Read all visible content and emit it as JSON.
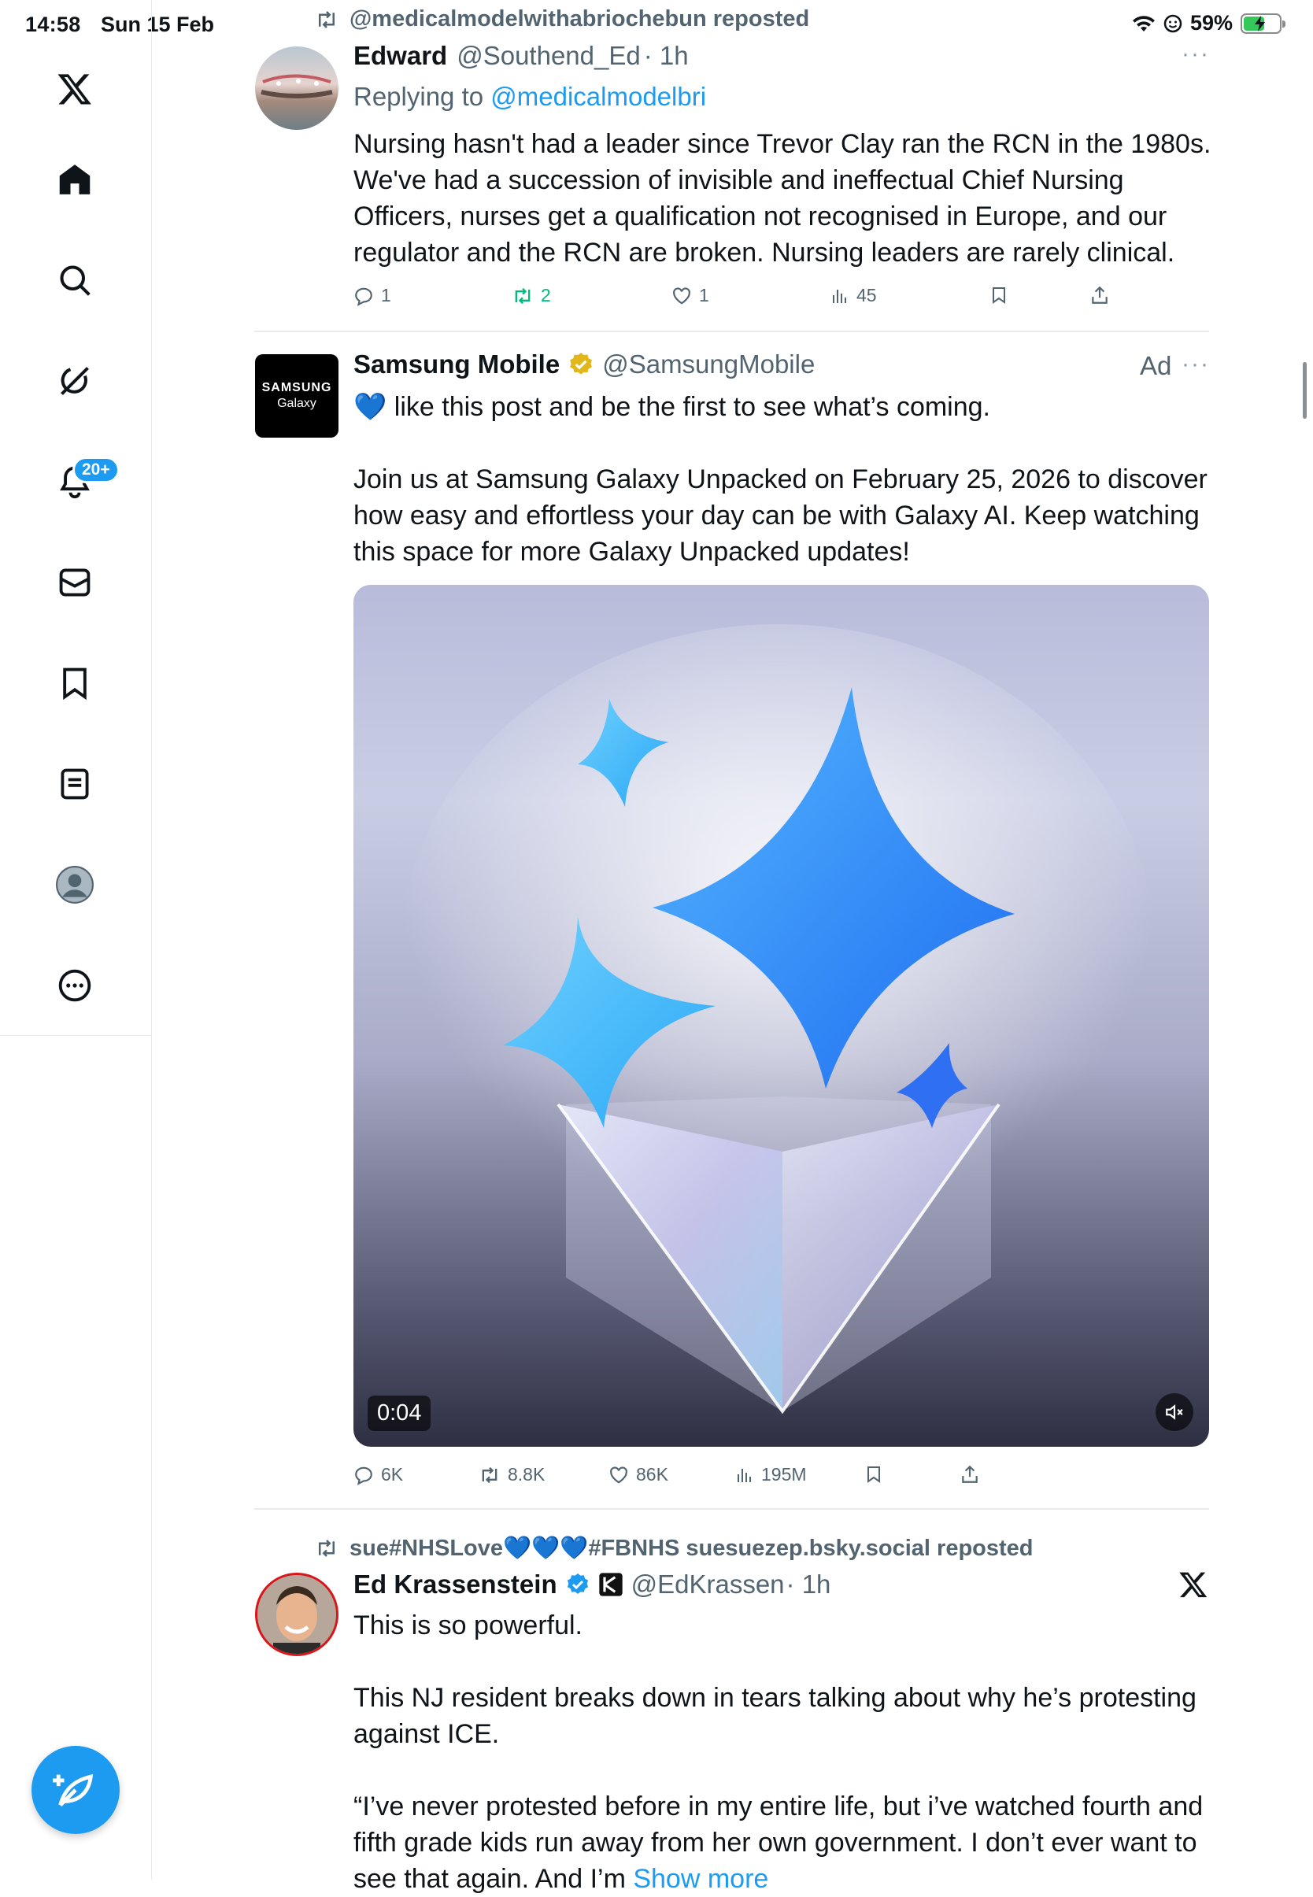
{
  "status_bar": {
    "time": "14:58",
    "date": "Sun 15 Feb",
    "battery": "59%",
    "battery_level": 0.59
  },
  "sidebar": {
    "items": [
      "x-logo",
      "home",
      "search",
      "grok",
      "notifications",
      "messages",
      "bookmarks",
      "lists",
      "profile",
      "more"
    ],
    "notification_badge": "20+"
  },
  "posts": [
    {
      "reposted_by": "@medicalmodelwithabriochebun reposted",
      "name": "Edward",
      "handle": "@Southend_Ed",
      "time": "· 1h",
      "replying_prefix": "Replying to ",
      "replying_to": "@medicalmodelbri",
      "text": "Nursing hasn't had a leader since Trevor Clay ran the RCN in the 1980s. We've had a succession of invisible and ineffectual Chief Nursing Officers, nurses get a qualification not recognised in Europe, and our regulator and the RCN are broken. Nursing leaders are rarely clinical.",
      "replies": "1",
      "reposts": "2",
      "likes": "1",
      "views": "45"
    },
    {
      "name": "Samsung Mobile",
      "handle": "@SamsungMobile",
      "ad_label": "Ad",
      "avatar_line1": "SAMSUNG",
      "avatar_line2": "Galaxy",
      "text1": "💙 like this post and be the first to see what’s coming.",
      "text2": "Join us at Samsung Galaxy Unpacked on February 25, 2026 to discover how easy and effortless your day can be with Galaxy AI. Keep watching this space for more Galaxy Unpacked updates!",
      "video_time": "0:04",
      "replies": "6K",
      "reposts": "8.8K",
      "likes": "86K",
      "views": "195M"
    },
    {
      "reposted_by": "sue#NHSLove💙💙💙#FBNHS suesuezep.bsky.social reposted",
      "name": "Ed Krassenstein",
      "handle": "@EdKrassen",
      "time": "· 1h",
      "text1": "This is so powerful.",
      "text2": "This NJ resident breaks down in tears talking about why he’s protesting against ICE.",
      "text3": "“I’ve never protested before in my entire life, but i’ve watched fourth and fifth grade kids run away from her own government. I don’t ever want to see that again. And I’m ",
      "show_more": "Show more"
    }
  ],
  "colors": {
    "accent": "#1d9bf0",
    "repost_green": "#00ba7c",
    "secondary_text": "#536471",
    "battery_green": "#34c759"
  }
}
